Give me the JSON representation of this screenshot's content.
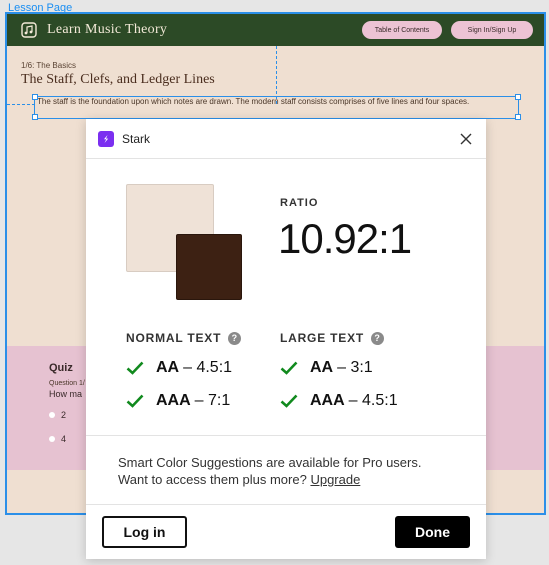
{
  "frame": {
    "label": "Lesson Page"
  },
  "app": {
    "title": "Learn Music Theory",
    "nav": {
      "toc": "Table of Contents",
      "signin": "Sign In/Sign Up"
    }
  },
  "lesson": {
    "breadcrumb": "1/6: The Basics",
    "title": "The Staff, Clefs, and Ledger Lines",
    "intro": "The staff is the foundation upon which notes are drawn. The modern staff consists comprises of five lines and four spaces."
  },
  "quiz": {
    "title": "Quiz",
    "question_label": "Question 1/",
    "question_text": "How ma",
    "options": [
      "2",
      "4"
    ]
  },
  "stark": {
    "name": "Stark",
    "ratio_label": "RATIO",
    "ratio_value": "10.92:1",
    "colors": {
      "background": "#efe2d7",
      "foreground": "#3d2113",
      "accent": "#7b2ff0",
      "pass": "#118a1e"
    },
    "normal_text": {
      "heading": "NORMAL TEXT",
      "aa_label": "AA",
      "aa_value": "– 4.5:1",
      "aaa_label": "AAA",
      "aaa_value": "– 7:1"
    },
    "large_text": {
      "heading": "LARGE TEXT",
      "aa_label": "AA",
      "aa_value": "– 3:1",
      "aaa_label": "AAA",
      "aaa_value": "– 4.5:1"
    },
    "upsell_line1": "Smart Color Suggestions are available for Pro users.",
    "upsell_line2": "Want to access them plus more?",
    "upgrade_link": "Upgrade",
    "login_button": "Log in",
    "done_button": "Done"
  }
}
